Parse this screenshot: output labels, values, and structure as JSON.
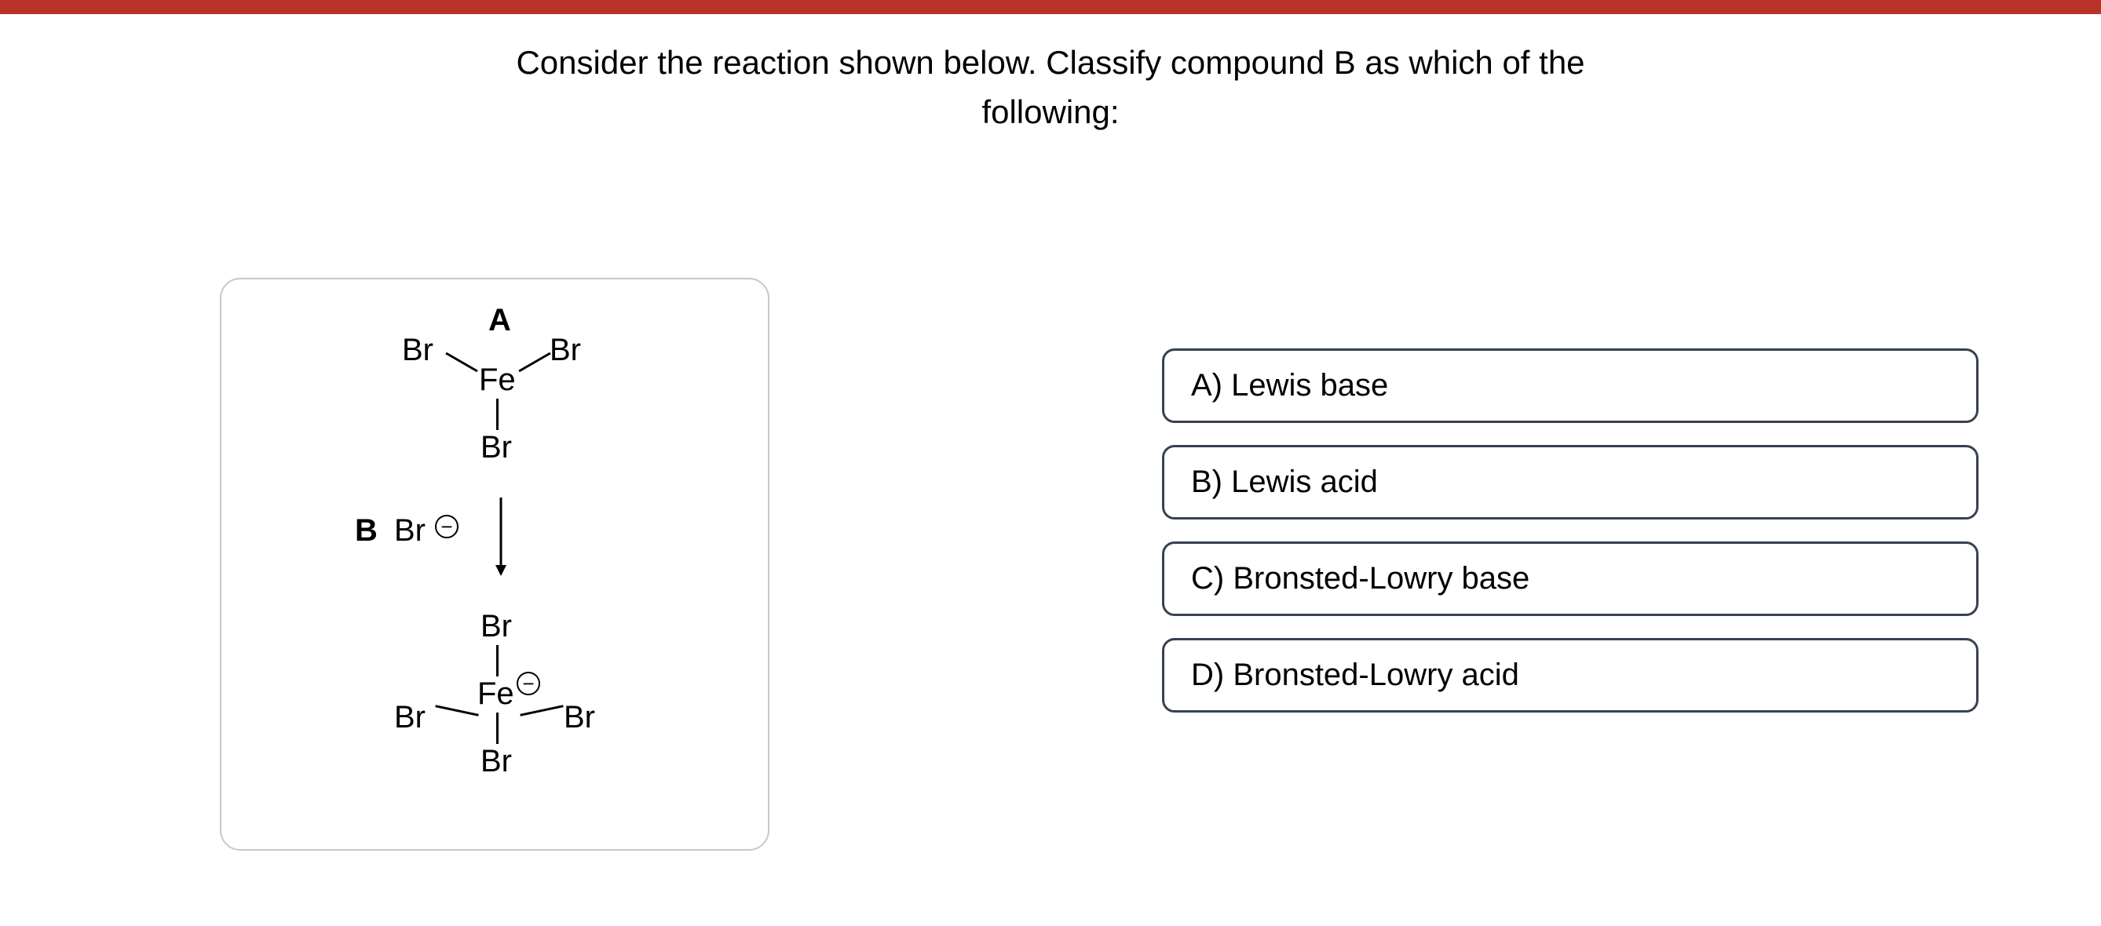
{
  "question": {
    "line1": "Consider the reaction shown below. Classify compound B as which of the",
    "line2": "following:"
  },
  "diagram": {
    "labelA": "A",
    "labelB": "B",
    "fe": "Fe",
    "br": "Br",
    "minus": "−"
  },
  "answers": {
    "a": "A) Lewis base",
    "b": "B) Lewis acid",
    "c": "C) Bronsted-Lowry base",
    "d": "D) Bronsted-Lowry acid"
  }
}
